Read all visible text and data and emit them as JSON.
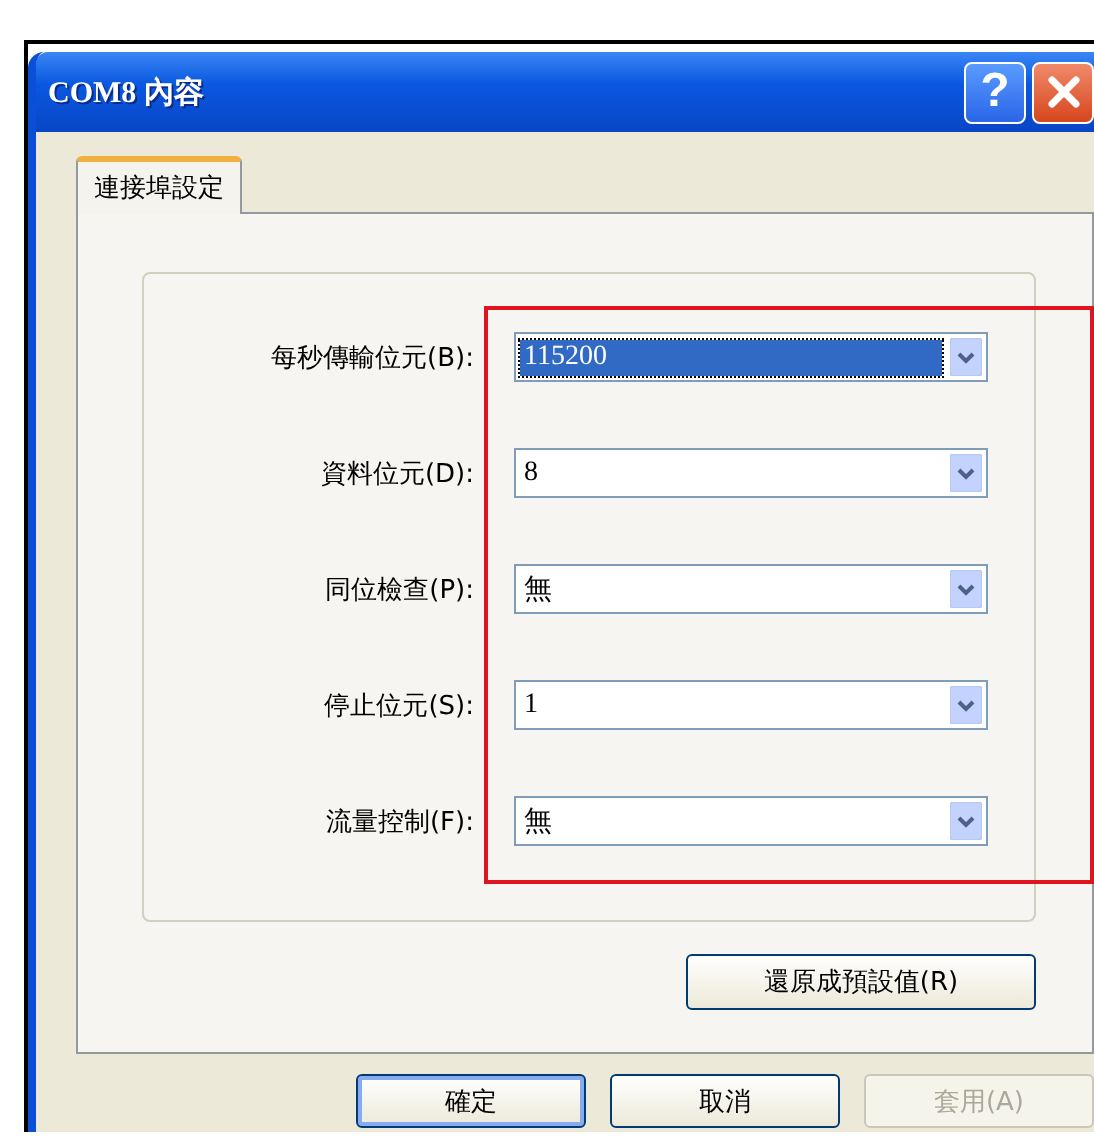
{
  "window": {
    "title": "COM8 內容",
    "help": "?"
  },
  "tabs": [
    {
      "label": "連接埠設定",
      "selected": true
    }
  ],
  "fields": [
    {
      "label": "每秒傳輸位元(B):",
      "value": "115200",
      "selected": true
    },
    {
      "label": "資料位元(D):",
      "value": "8",
      "selected": false
    },
    {
      "label": "同位檢查(P):",
      "value": "無",
      "selected": false
    },
    {
      "label": "停止位元(S):",
      "value": "1",
      "selected": false
    },
    {
      "label": "流量控制(F):",
      "value": "無",
      "selected": false
    }
  ],
  "restore_button": "還原成預設值(R)",
  "buttons": [
    {
      "label": "確定",
      "disabled": false,
      "default": true
    },
    {
      "label": "取消",
      "disabled": false,
      "default": false
    },
    {
      "label": "套用(A)",
      "disabled": true,
      "default": false
    }
  ]
}
